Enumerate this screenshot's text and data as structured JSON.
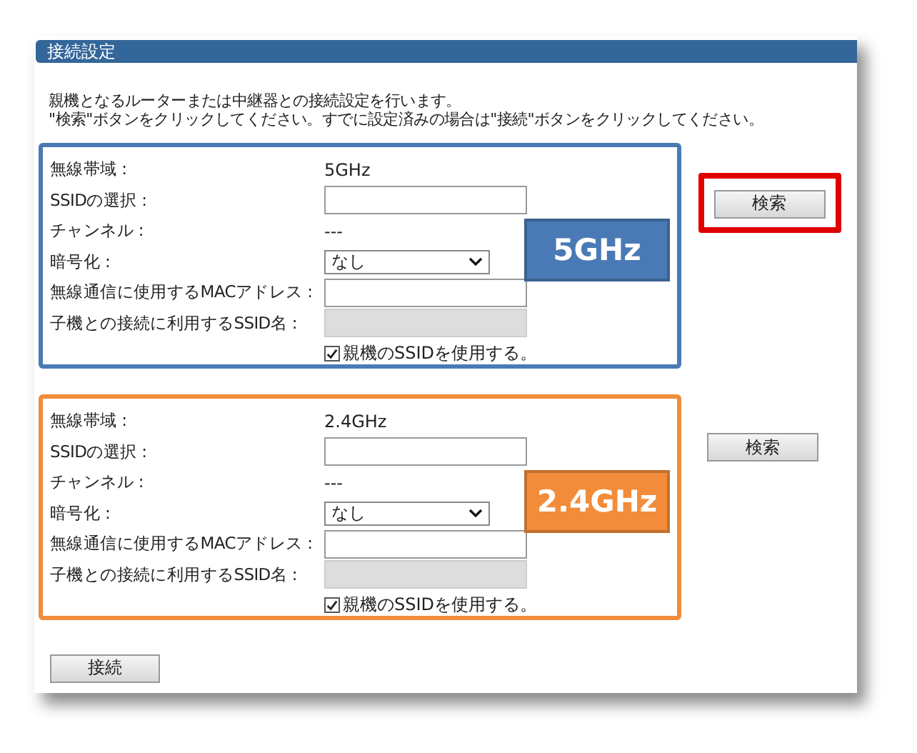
{
  "panel": {
    "title": "接続設定"
  },
  "intro": [
    "親機となるルーターまたは中継器との接続設定を行います。",
    "\"検索\"ボタンをクリックしてください。すでに設定済みの場合は\"接続\"ボタンをクリックしてください。"
  ],
  "bands": [
    {
      "color": "#4a7ab5",
      "callout": "5GHz",
      "search_button": {
        "label": "検索",
        "highlighted": true
      },
      "rows": [
        {
          "kind": "text",
          "label": "無線帯域 :",
          "value": "5GHz"
        },
        {
          "kind": "input",
          "label": "SSIDの選択 :",
          "disabled": false
        },
        {
          "kind": "text",
          "label": "チャンネル :",
          "value": "---"
        },
        {
          "kind": "select",
          "label": "暗号化 :",
          "value": "なし"
        },
        {
          "kind": "input",
          "label": "無線通信に使用するMACアドレス :",
          "disabled": false
        },
        {
          "kind": "input",
          "label": "子機との接続に利用するSSID名 :",
          "disabled": true
        },
        {
          "kind": "checkbox",
          "label": "親機のSSIDを使用する。",
          "checked": true
        }
      ]
    },
    {
      "color": "#f28c3a",
      "callout": "2.4GHz",
      "search_button": {
        "label": "検索",
        "highlighted": false
      },
      "rows": [
        {
          "kind": "text",
          "label": "無線帯域 :",
          "value": "2.4GHz"
        },
        {
          "kind": "input",
          "label": "SSIDの選択 :",
          "disabled": false
        },
        {
          "kind": "text",
          "label": "チャンネル :",
          "value": "---"
        },
        {
          "kind": "select",
          "label": "暗号化 :",
          "value": "なし"
        },
        {
          "kind": "input",
          "label": "無線通信に使用するMACアドレス :",
          "disabled": false
        },
        {
          "kind": "input",
          "label": "子機との接続に利用するSSID名 :",
          "disabled": true
        },
        {
          "kind": "checkbox",
          "label": "親機のSSIDを使用する。",
          "checked": true
        }
      ]
    }
  ],
  "connect_button": {
    "label": "接続"
  }
}
